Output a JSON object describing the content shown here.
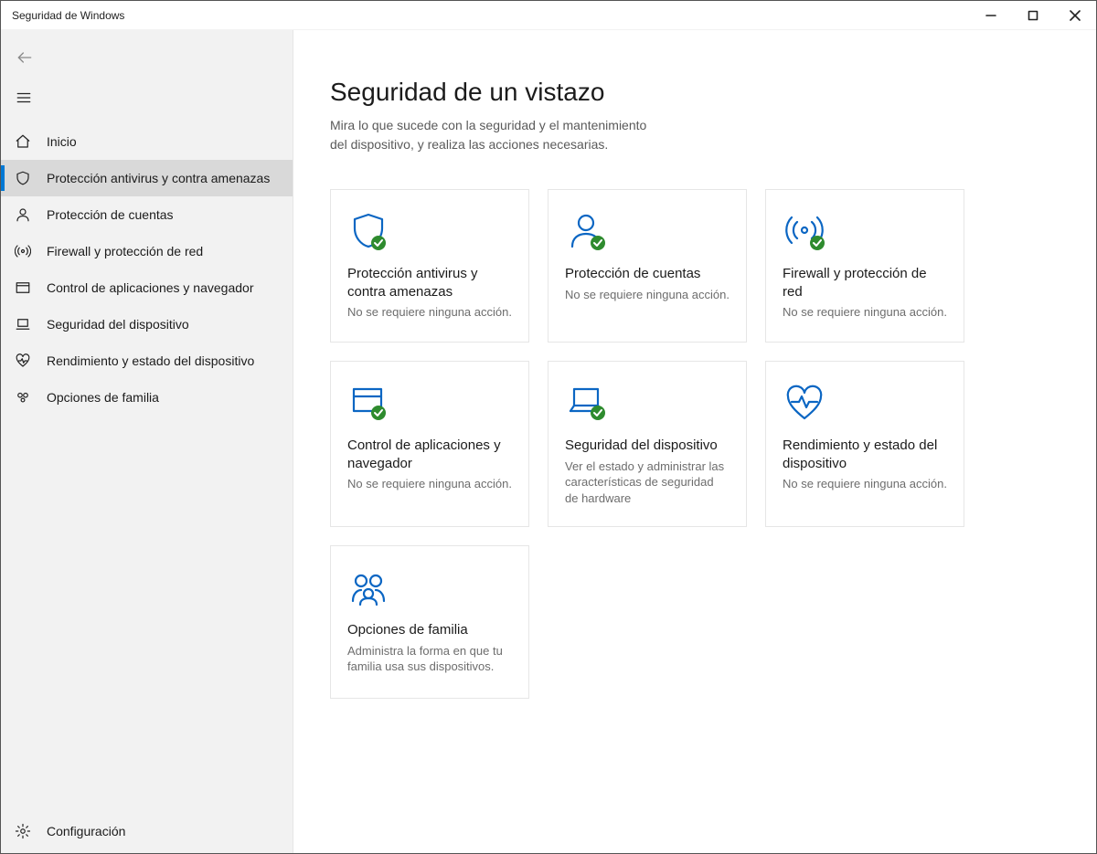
{
  "window_title": "Seguridad de Windows",
  "sidebar": {
    "items": [
      {
        "label": "Inicio"
      },
      {
        "label": "Protección antivirus y contra amenazas"
      },
      {
        "label": "Protección de cuentas"
      },
      {
        "label": "Firewall y protección de red"
      },
      {
        "label": "Control de aplicaciones y navegador"
      },
      {
        "label": "Seguridad del dispositivo"
      },
      {
        "label": "Rendimiento y estado del dispositivo"
      },
      {
        "label": "Opciones de familia"
      }
    ],
    "settings_label": "Configuración"
  },
  "main": {
    "title": "Seguridad de un vistazo",
    "subtitle": "Mira lo que sucede con la seguridad y el mantenimiento del dispositivo, y realiza las acciones necesarias.",
    "cards": [
      {
        "title": "Protección antivirus y contra amenazas",
        "desc": "No se requiere ninguna acción."
      },
      {
        "title": "Protección de cuentas",
        "desc": "No se requiere ninguna acción."
      },
      {
        "title": "Firewall y protección de red",
        "desc": "No se requiere ninguna acción."
      },
      {
        "title": "Control de aplicaciones y navegador",
        "desc": "No se requiere ninguna acción."
      },
      {
        "title": "Seguridad del dispositivo",
        "desc": "Ver el estado y administrar las características de seguridad de hardware"
      },
      {
        "title": "Rendimiento y estado del dispositivo",
        "desc": "No se requiere ninguna acción."
      },
      {
        "title": "Opciones de familia",
        "desc": "Administra la forma en que tu familia usa sus dispositivos."
      }
    ]
  }
}
